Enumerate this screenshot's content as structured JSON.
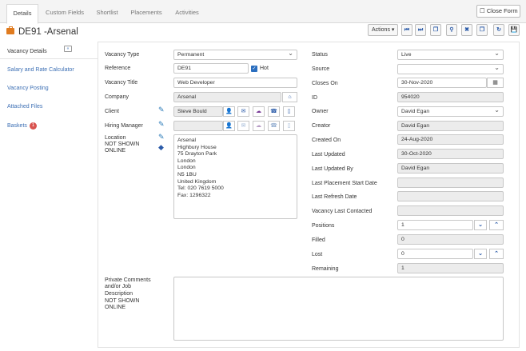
{
  "tabs": [
    "Details",
    "Custom Fields",
    "Shortlist",
    "Placements",
    "Activities"
  ],
  "close_label": "Close Form",
  "title": "DE91 -Arsenal",
  "actions_label": "Actions",
  "sidebar": {
    "items": [
      {
        "label": "Vacancy Details"
      },
      {
        "label": "Salary and Rate Calculator"
      },
      {
        "label": "Vacancy Posting"
      },
      {
        "label": "Attached Files"
      },
      {
        "label": "Baskets",
        "badge": "1"
      }
    ]
  },
  "left": {
    "vacancy_type": {
      "label": "Vacancy Type",
      "value": "Permanent"
    },
    "reference": {
      "label": "Reference",
      "value": "DE91",
      "hot_label": "Hot"
    },
    "vacancy_title": {
      "label": "Vacancy Title",
      "value": "Web Developer"
    },
    "company": {
      "label": "Company",
      "value": "Arsenal"
    },
    "client": {
      "label": "Client",
      "value": "Steve Bould"
    },
    "hiring_manager": {
      "label": "Hiring Manager",
      "value": ""
    },
    "location": {
      "label": "Location",
      "note1": "NOT SHOWN",
      "note2": "ONLINE",
      "address": "Arsenal\nHighbury House\n75 Drayton Park\nLondon\nLondon\nN5 1BU\nUnited Kingdom\nTel: 020 7619 5000\nFax: 1296322"
    },
    "private_comments": {
      "l1": "Private Comments",
      "l2": "and/or Job",
      "l3": "Description",
      "l4": "NOT SHOWN",
      "l5": "ONLINE",
      "value": ""
    }
  },
  "right": {
    "status": {
      "label": "Status",
      "value": "Live"
    },
    "source": {
      "label": "Source",
      "value": ""
    },
    "closes_on": {
      "label": "Closes On",
      "value": "30-Nov-2020"
    },
    "id": {
      "label": "ID",
      "value": "954020"
    },
    "owner": {
      "label": "Owner",
      "value": "David Egan"
    },
    "creator": {
      "label": "Creator",
      "value": "David Egan"
    },
    "created_on": {
      "label": "Created On",
      "value": "24-Aug-2020"
    },
    "last_updated": {
      "label": "Last Updated",
      "value": "30-Oct-2020"
    },
    "last_updated_by": {
      "label": "Last Updated By",
      "value": "David Egan"
    },
    "last_placement_start": {
      "label": "Last Placement Start Date",
      "value": ""
    },
    "last_refresh": {
      "label": "Last Refresh Date",
      "value": ""
    },
    "vacancy_last_contacted": {
      "label": "Vacancy Last Contacted",
      "value": ""
    },
    "positions": {
      "label": "Positions",
      "value": "1"
    },
    "filled": {
      "label": "Filled",
      "value": "0"
    },
    "lost": {
      "label": "Lost",
      "value": "0"
    },
    "remaining": {
      "label": "Remaining",
      "value": "1"
    }
  }
}
